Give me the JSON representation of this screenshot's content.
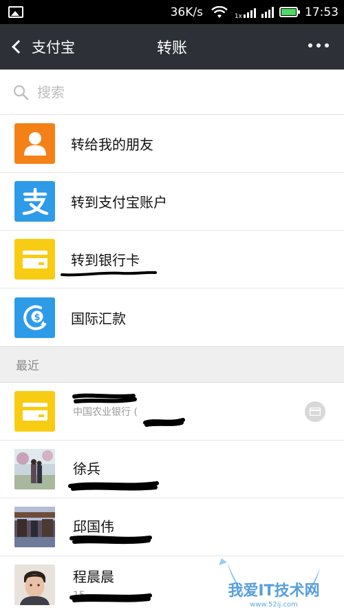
{
  "status_bar": {
    "speed": "36K/s",
    "time": "17:53",
    "network_small": "1x"
  },
  "nav": {
    "back_label": "支付宝",
    "title": "转账"
  },
  "search": {
    "placeholder": "搜索"
  },
  "transfer_options": [
    {
      "label": "转给我的朋友",
      "icon": "person-icon",
      "color": "#f48118"
    },
    {
      "label": "转到支付宝账户",
      "icon": "alipay-icon",
      "color": "#2e9be8"
    },
    {
      "label": "转到银行卡",
      "icon": "bank-card-icon",
      "color": "#f9cc14"
    },
    {
      "label": "国际汇款",
      "icon": "international-remit-icon",
      "color": "#2e9be8"
    }
  ],
  "recent": {
    "header": "最近",
    "items": [
      {
        "name": "",
        "sub": "中国农业银行 (",
        "avatar": "bank-card-icon"
      },
      {
        "name": "徐兵",
        "sub": "",
        "avatar": "photo"
      },
      {
        "name": "邱国伟",
        "sub": "",
        "avatar": "photo"
      },
      {
        "name": "程晨晨",
        "sub": "15",
        "avatar": "photo"
      }
    ]
  },
  "watermark": {
    "text": "我爱IT技术网",
    "url": "www.52ij.com"
  },
  "colors": {
    "nav_bg": "#2e3038",
    "card_yellow": "#f9cc14",
    "alipay_blue": "#2e9be8",
    "orange": "#f48118"
  }
}
